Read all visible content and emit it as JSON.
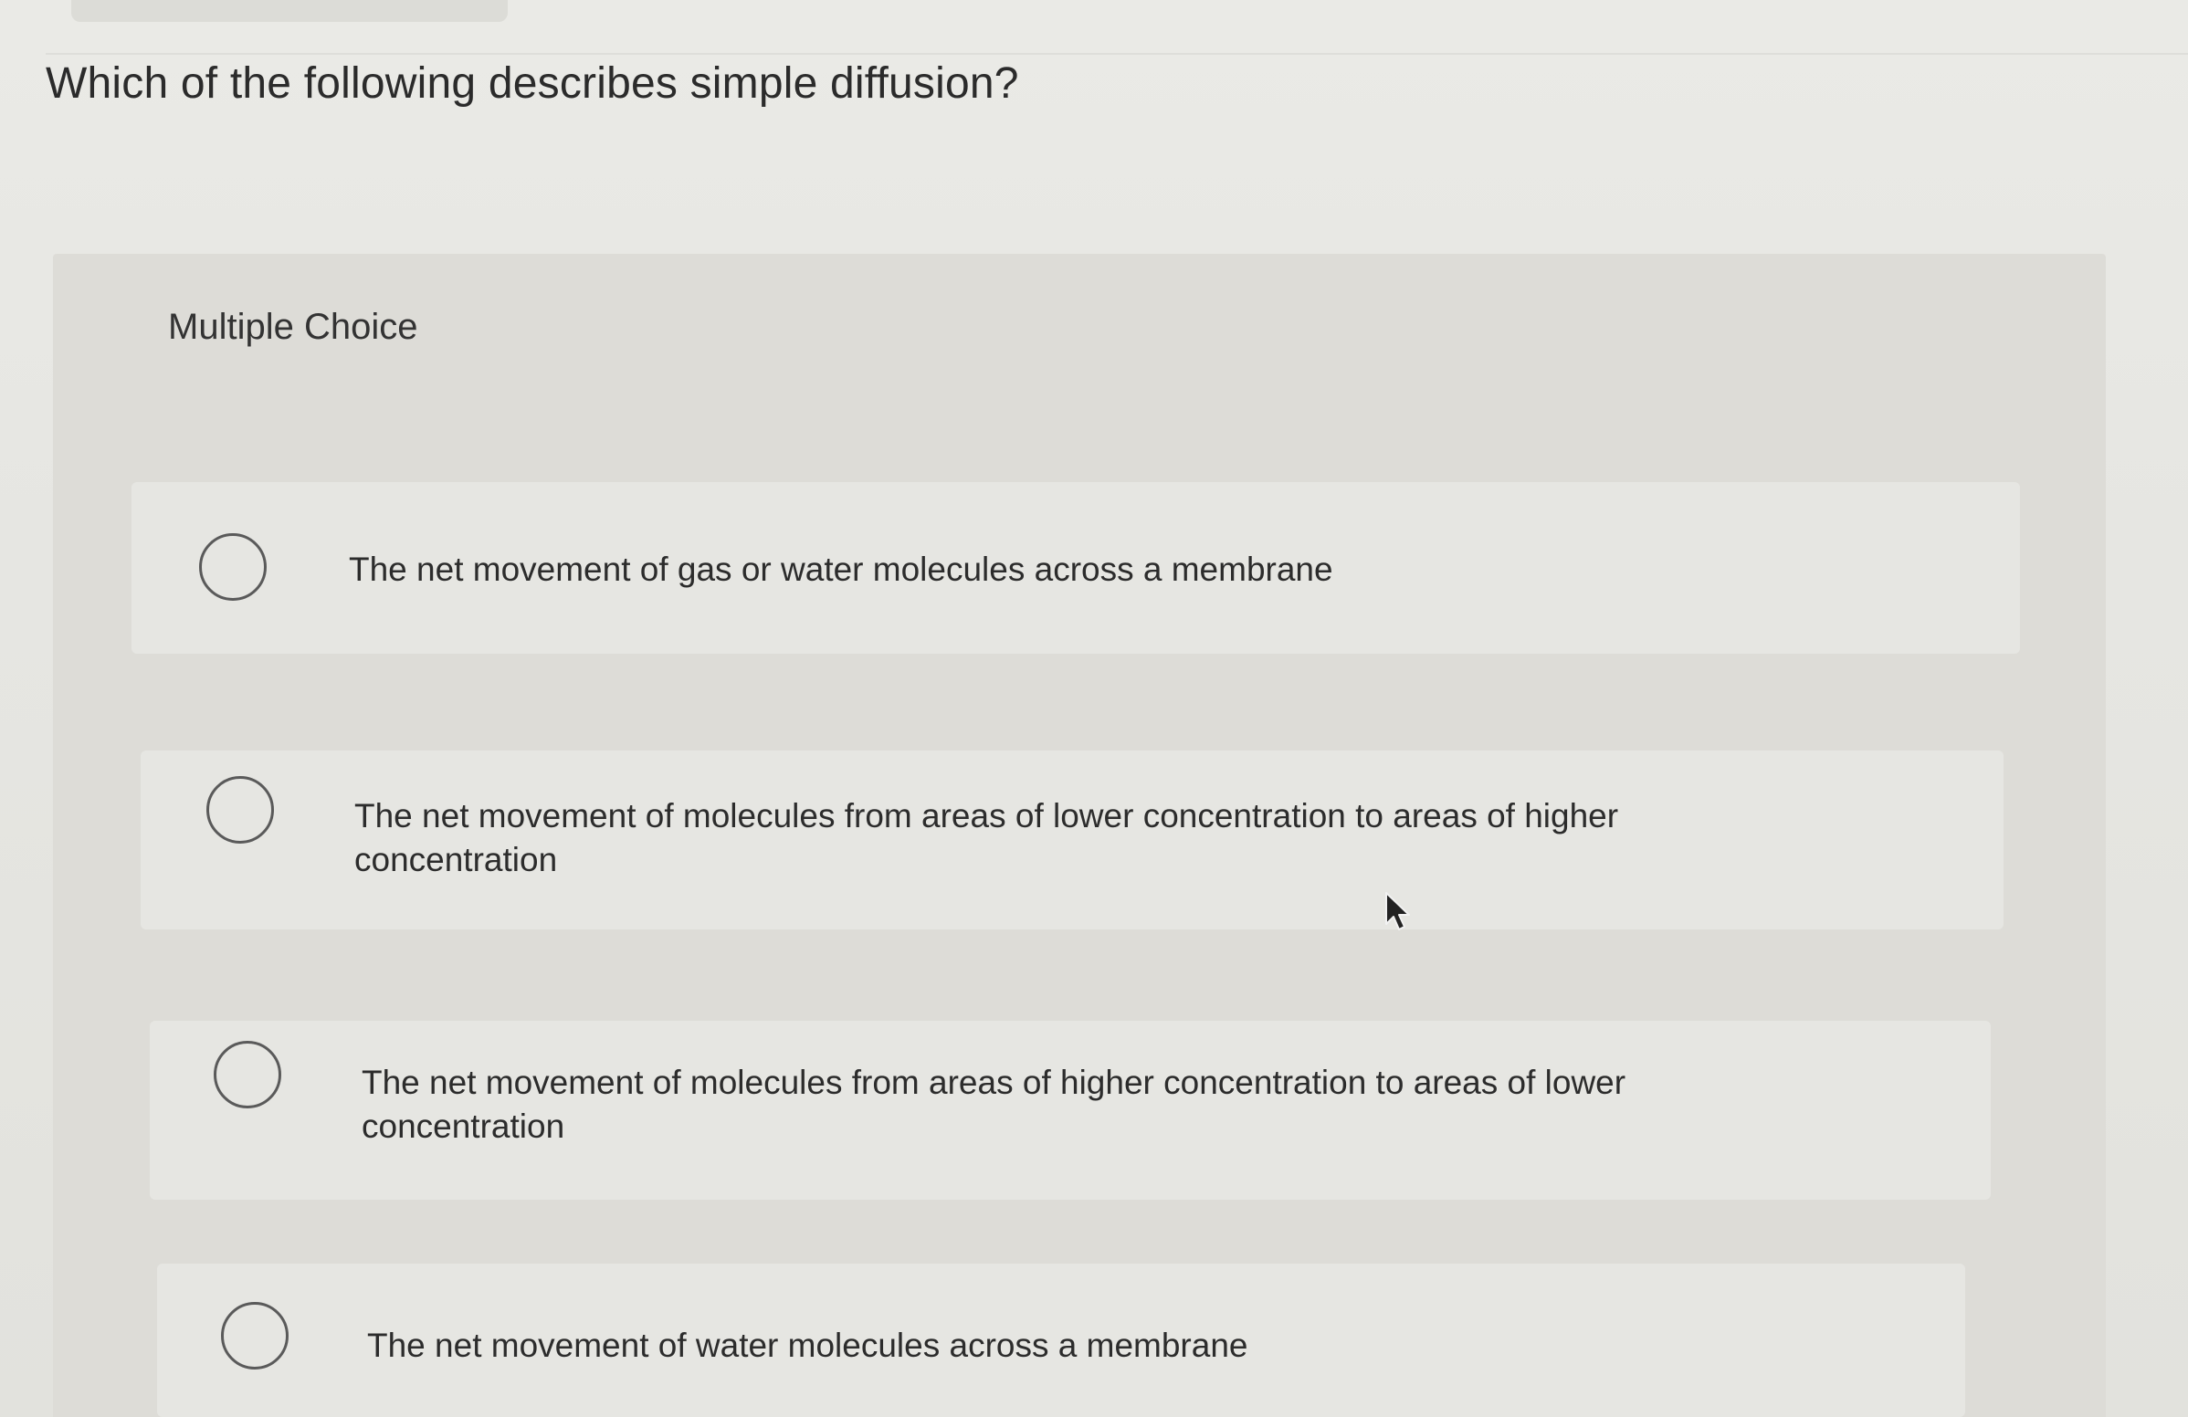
{
  "question": {
    "text": "Which of the following describes simple diffusion?"
  },
  "panel": {
    "label": "Multiple Choice"
  },
  "options": [
    {
      "text": "The net movement of gas or water molecules across a membrane",
      "selected": false
    },
    {
      "text": "The net movement of molecules from areas of lower concentration to areas of higher concentration",
      "selected": false
    },
    {
      "text": "The net movement of molecules from areas of higher concentration to areas of lower concentration",
      "selected": false
    },
    {
      "text": "The net movement of water molecules across a membrane",
      "selected": false
    }
  ],
  "colors": {
    "background": "#e6e6e2",
    "panel": "#dddcd7",
    "text": "#2b2b2b",
    "radio_border": "#5a5a5a"
  }
}
